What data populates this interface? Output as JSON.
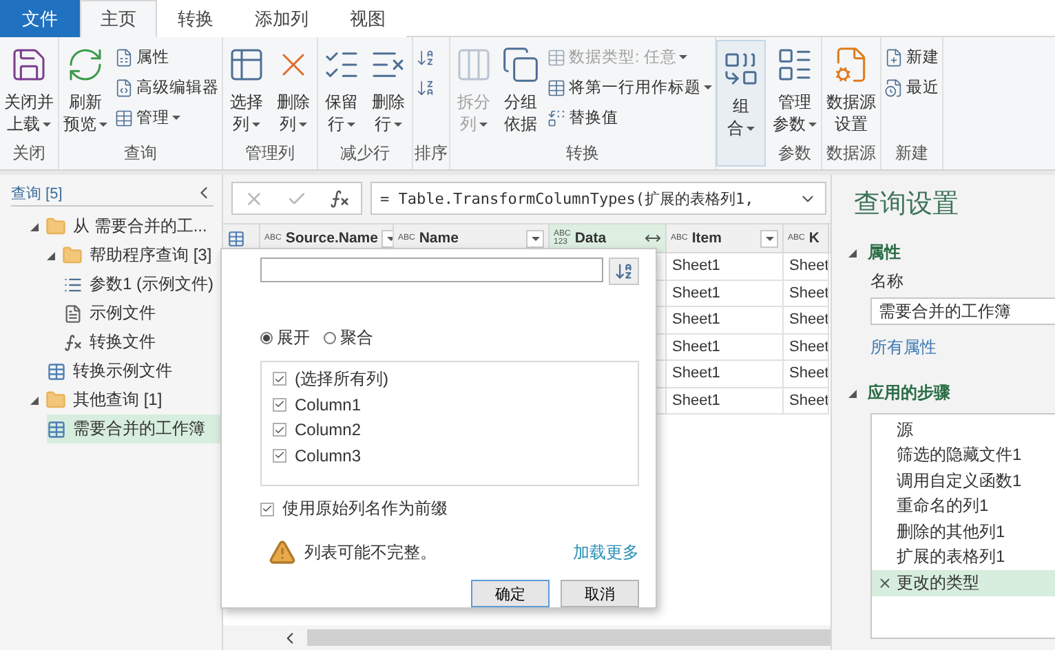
{
  "tabs": [
    {
      "label": "文件",
      "kind": "file",
      "selected": false
    },
    {
      "label": "主页",
      "kind": "tab",
      "selected": true
    },
    {
      "label": "转换",
      "kind": "tab",
      "selected": false
    },
    {
      "label": "添加列",
      "kind": "tab",
      "selected": false
    },
    {
      "label": "视图",
      "kind": "tab",
      "selected": false
    }
  ],
  "ribbon": {
    "groups": [
      {
        "label": "关闭",
        "highlighted": false,
        "items": [
          {
            "kind": "large",
            "lines": [
              "关闭并",
              "上载"
            ],
            "dropdown": true,
            "disabled": false
          }
        ]
      },
      {
        "label": "查询",
        "highlighted": false,
        "items": [
          {
            "kind": "large",
            "lines": [
              "刷新",
              "预览"
            ],
            "dropdown": true,
            "disabled": false
          },
          {
            "kind": "stack",
            "entries": [
              {
                "label": "属性",
                "dropdown": false,
                "disabled": false
              },
              {
                "label": "高级编辑器",
                "dropdown": false,
                "disabled": false
              },
              {
                "label": "管理",
                "dropdown": true,
                "disabled": false
              }
            ]
          }
        ]
      },
      {
        "label": "管理列",
        "highlighted": false,
        "items": [
          {
            "kind": "large",
            "lines": [
              "选择",
              "列"
            ],
            "dropdown": true,
            "disabled": false
          },
          {
            "kind": "large",
            "lines": [
              "删除",
              "列"
            ],
            "dropdown": true,
            "disabled": false
          }
        ]
      },
      {
        "label": "减少行",
        "highlighted": false,
        "items": [
          {
            "kind": "large",
            "lines": [
              "保留",
              "行"
            ],
            "dropdown": true,
            "disabled": false
          },
          {
            "kind": "large",
            "lines": [
              "删除",
              "行"
            ],
            "dropdown": true,
            "disabled": false
          }
        ]
      },
      {
        "label": "排序",
        "highlighted": false,
        "items": [
          {
            "kind": "stack",
            "entries": [
              {
                "disabled": false
              },
              {
                "disabled": false
              }
            ]
          }
        ]
      },
      {
        "label": "转换",
        "highlighted": false,
        "items": [
          {
            "kind": "large",
            "lines": [
              "拆分",
              "列"
            ],
            "dropdown": true,
            "disabled": true
          },
          {
            "kind": "large",
            "lines": [
              "分组",
              "依据"
            ],
            "dropdown": false,
            "disabled": false
          },
          {
            "kind": "stack",
            "entries": [
              {
                "label": "数据类型: 任意",
                "dropdown": true,
                "disabled": true
              },
              {
                "label": "将第一行用作标题",
                "dropdown": true,
                "disabled": false
              },
              {
                "label": "替换值",
                "dropdown": false,
                "disabled": false
              }
            ]
          }
        ]
      },
      {
        "highlighted": true,
        "items": [
          {
            "kind": "large",
            "lines": [
              "组",
              "合"
            ],
            "dropdown": true,
            "disabled": false
          }
        ]
      },
      {
        "label": "参数",
        "highlighted": false,
        "items": [
          {
            "kind": "large",
            "lines": [
              "管理",
              "参数"
            ],
            "dropdown": true,
            "disabled": false
          }
        ]
      },
      {
        "label": "数据源",
        "highlighted": false,
        "items": [
          {
            "kind": "large",
            "lines": [
              "数据源",
              "设置"
            ],
            "dropdown": false,
            "disabled": false
          }
        ]
      },
      {
        "label": "新建",
        "highlighted": false,
        "items": [
          {
            "kind": "stack",
            "entries": [
              {
                "label": "新建",
                "dropdown": false,
                "disabled": false
              },
              {
                "label": "最近",
                "dropdown": false,
                "disabled": false
              }
            ]
          }
        ]
      }
    ]
  },
  "queries": {
    "title": "查询 [5]",
    "items": [
      {
        "label": "从 需要合并的工...",
        "kind": "folder",
        "expanded": true,
        "selected": false,
        "children": [
          {
            "label": "帮助程序查询 [3]",
            "kind": "folder",
            "expanded": true,
            "selected": false,
            "children": [
              {
                "label": "参数1 (示例文件)",
                "kind": "parameter",
                "selected": false
              },
              {
                "label": "示例文件",
                "kind": "document",
                "selected": false
              },
              {
                "label": "转换文件",
                "kind": "function",
                "selected": false
              }
            ]
          },
          {
            "label": "转换示例文件",
            "kind": "table",
            "selected": false
          }
        ]
      },
      {
        "label": "其他查询 [1]",
        "kind": "folder",
        "expanded": true,
        "selected": false,
        "children": [
          {
            "label": "需要合并的工作簿",
            "kind": "table",
            "selected": true
          }
        ]
      }
    ]
  },
  "formula_bar": {
    "formula": "= Table.TransformColumnTypes(扩展的表格列1,"
  },
  "table": {
    "columns": [
      {
        "type_label": [
          "ABC"
        ],
        "name": "Source.Name",
        "kind": "filter",
        "highlighted": false
      },
      {
        "type_label": [
          "ABC"
        ],
        "name": "Name",
        "kind": "filter",
        "highlighted": false
      },
      {
        "type_label": [
          "ABC",
          "123"
        ],
        "name": "Data",
        "kind": "expand",
        "highlighted": true
      },
      {
        "type_label": [
          "ABC"
        ],
        "name": "Item",
        "kind": "filter",
        "highlighted": false
      },
      {
        "type_label": [
          "ABC"
        ],
        "name": "K",
        "kind": "plain",
        "highlighted": false
      }
    ],
    "rows": [
      [
        "Sheet1",
        "Sheet"
      ],
      [
        "Sheet1",
        "Sheet"
      ],
      [
        "Sheet1",
        "Sheet"
      ],
      [
        "Sheet1",
        "Sheet"
      ],
      [
        "Sheet1",
        "Sheet"
      ],
      [
        "Sheet1",
        "Sheet"
      ]
    ]
  },
  "expand_dialog": {
    "modes": [
      {
        "label": "展开",
        "selected": true
      },
      {
        "label": "聚合",
        "selected": false
      }
    ],
    "columns": [
      {
        "label": "(选择所有列)",
        "checked": true
      },
      {
        "label": "Column1",
        "checked": true
      },
      {
        "label": "Column2",
        "checked": true
      },
      {
        "label": "Column3",
        "checked": true
      }
    ],
    "prefix": {
      "label": "使用原始列名作为前缀",
      "checked": true
    },
    "warning": "列表可能不完整。",
    "load_more": "加载更多",
    "buttons": [
      {
        "label": "确定",
        "kind": "primary"
      },
      {
        "label": "取消",
        "kind": "secondary"
      }
    ]
  },
  "query_settings": {
    "title": "查询设置",
    "properties": {
      "label": "属性",
      "expanded": true,
      "name_label": "名称",
      "name_value": "需要合并的工作簿",
      "all_properties": "所有属性"
    },
    "steps": {
      "label": "应用的步骤",
      "expanded": true,
      "items": [
        {
          "label": "源",
          "selected": false
        },
        {
          "label": "筛选的隐藏文件1",
          "selected": false
        },
        {
          "label": "调用自定义函数1",
          "selected": false
        },
        {
          "label": "重命名的列1",
          "selected": false
        },
        {
          "label": "删除的其他列1",
          "selected": false
        },
        {
          "label": "扩展的表格列1",
          "selected": false
        },
        {
          "label": "更改的类型",
          "selected": true
        }
      ]
    }
  }
}
